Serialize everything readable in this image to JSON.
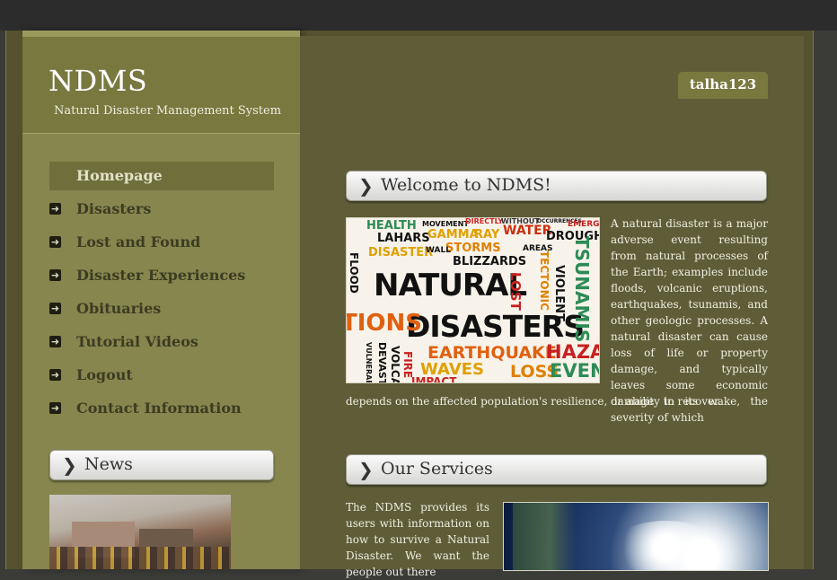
{
  "brand": {
    "title": "NDMS",
    "subtitle": "Natural Disaster Management System"
  },
  "user": {
    "name": "talha123"
  },
  "nav": {
    "items": [
      {
        "label": "Homepage",
        "active": true
      },
      {
        "label": "Disasters",
        "active": false
      },
      {
        "label": "Lost and Found",
        "active": false
      },
      {
        "label": "Disaster Experiences",
        "active": false
      },
      {
        "label": "Obituaries",
        "active": false
      },
      {
        "label": "Tutorial Videos",
        "active": false
      },
      {
        "label": "Logout",
        "active": false
      },
      {
        "label": "Contact Information",
        "active": false
      }
    ]
  },
  "news": {
    "title": "News"
  },
  "welcome": {
    "title": "Welcome to NDMS!",
    "body": "A natural disaster is a major adverse event resulting from natural processes of the Earth; examples include floods, volcanic eruptions, earthquakes, tsunamis, and other geologic processes. A natural disaster can cause loss of life or property damage, and typically leaves some economic damage in its wake, the severity of which",
    "body_tail": "depends on the affected population's resilience, or ability to recover."
  },
  "services": {
    "title": "Our Services",
    "body": "The NDMS provides its users with information on how to survive a Natural Disaster. We want the people out there"
  },
  "word_cloud": {
    "words": [
      "HEALTH",
      "MOVEMENT",
      "DIRECTLY",
      "WITHOUT",
      "OCCURRENCES",
      "LAHARS",
      "GAMMA",
      "RAY",
      "WATER",
      "DROUGHT",
      "EMERGE",
      "STORMS",
      "DISASTER",
      "WALL",
      "BLIZZARDS",
      "AREAS",
      "NATURAL",
      "DISASTERS",
      "TIONS",
      "TSUNAMIS",
      "EARTHQUAKE",
      "HAZARD",
      "WAVES",
      "LOSS",
      "EVENT",
      "IMPACT",
      "FIRE",
      "VIOLENT",
      "TECTONIC",
      "LOST",
      "VOLCANIC",
      "VULNERABILITY",
      "DEVASTATING",
      "FLOOD"
    ]
  },
  "colors": {
    "frame": "#55532f",
    "sidebar": "#86864e",
    "main": "#5e5d38",
    "accent_text": "#efefe0"
  }
}
